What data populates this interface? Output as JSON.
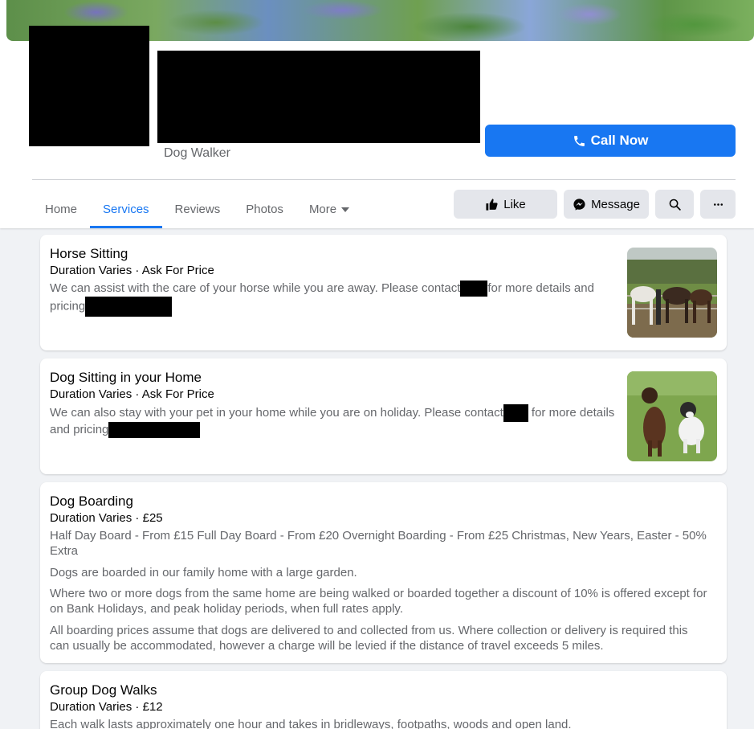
{
  "page": {
    "category": "Dog Walker",
    "call_button_label": "Call Now"
  },
  "tabs": [
    {
      "label": "Home"
    },
    {
      "label": "Services",
      "active": true
    },
    {
      "label": "Reviews"
    },
    {
      "label": "Photos"
    },
    {
      "label": "More"
    }
  ],
  "actions": {
    "like_label": "Like",
    "message_label": "Message"
  },
  "services": [
    {
      "title": "Horse Sitting",
      "meta": "Duration Varies · Ask For Price",
      "desc_part1": "We can assist with the care of your horse while you are away. Please contact",
      "desc_part2": "for more details and",
      "desc_part3": "pricing"
    },
    {
      "title": "Dog Sitting in your Home",
      "meta": "Duration Varies · Ask For Price",
      "desc_part1": "We can also stay with your pet in your home while you are on holiday. Please contact",
      "desc_part2": "for more details",
      "desc_part3": "and pricing"
    },
    {
      "title": "Dog Boarding",
      "meta": "Duration Varies · £25",
      "paragraphs": [
        "Half Day Board - From £15 Full Day Board - From £20 Overnight Boarding - From £25 Christmas, New Years, Easter - 50% Extra",
        "Dogs are boarded in our family home with a large garden.",
        "Where two or more dogs from the same home are being walked or boarded together a discount of 10% is offered except for on Bank Holidays, and peak holiday periods, when full rates apply.",
        "All boarding prices assume that dogs are delivered to and collected from us. Where collection or delivery is required this can usually be accommodated, however a charge will be levied if the distance of travel exceeds 5 miles."
      ]
    },
    {
      "title": "Group Dog Walks",
      "meta": "Duration Varies · £12",
      "paragraphs": [
        "Each walk lasts approximately one hour and takes in bridleways, footpaths, woods and open land."
      ]
    }
  ],
  "icons": {
    "call": "phone-icon",
    "like": "thumbs-up-icon",
    "message": "messenger-icon",
    "search": "search-icon",
    "more": "ellipsis-icon",
    "tab_more": "caret-down-icon"
  },
  "colors": {
    "accent": "#1877f2",
    "secondary_text": "#65676b",
    "button_bg": "#e4e6eb",
    "page_bg": "#f0f2f5"
  }
}
